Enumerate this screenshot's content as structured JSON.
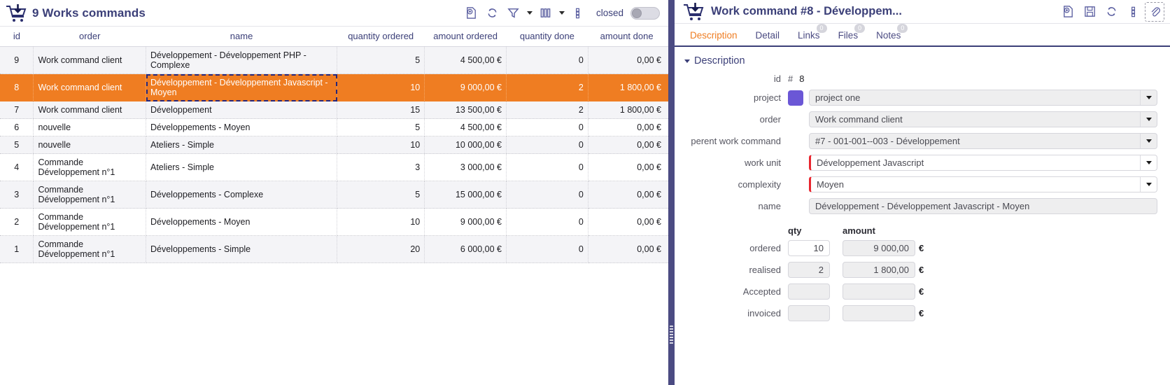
{
  "list_panel": {
    "icon": "cart-down-arrow-icon",
    "title": "9 Works commands",
    "toolbar": {
      "add_label": "add-document-icon",
      "refresh_label": "refresh-icon",
      "filter_label": "filter-icon",
      "columns_label": "columns-icon",
      "more_label": "more-vertical-icon",
      "closed_label": "closed",
      "closed_state": "off"
    },
    "columns": [
      "id",
      "order",
      "name",
      "quantity ordered",
      "amount ordered",
      "quantity done",
      "amount done"
    ],
    "rows": [
      {
        "id": "9",
        "order": "Work command client",
        "name": "Développement - Développement PHP - Complexe",
        "qty_ordered": "5",
        "amount_ordered": "4 500,00 €",
        "qty_done": "0",
        "amount_done": "0,00 €"
      },
      {
        "id": "8",
        "order": "Work command client",
        "name": "Développement - Développement Javascript - Moyen",
        "qty_ordered": "10",
        "amount_ordered": "9 000,00 €",
        "qty_done": "2",
        "amount_done": "1 800,00 €"
      },
      {
        "id": "7",
        "order": "Work command client",
        "name": "Développement",
        "qty_ordered": "15",
        "amount_ordered": "13 500,00 €",
        "qty_done": "2",
        "amount_done": "1 800,00 €"
      },
      {
        "id": "6",
        "order": "nouvelle",
        "name": "Développements - Moyen",
        "qty_ordered": "5",
        "amount_ordered": "4 500,00 €",
        "qty_done": "0",
        "amount_done": "0,00 €"
      },
      {
        "id": "5",
        "order": "nouvelle",
        "name": "Ateliers - Simple",
        "qty_ordered": "10",
        "amount_ordered": "10 000,00 €",
        "qty_done": "0",
        "amount_done": "0,00 €"
      },
      {
        "id": "4",
        "order": "Commande Développement n°1",
        "name": "Ateliers - Simple",
        "qty_ordered": "3",
        "amount_ordered": "3 000,00 €",
        "qty_done": "0",
        "amount_done": "0,00 €"
      },
      {
        "id": "3",
        "order": "Commande Développement n°1",
        "name": "Développements - Complexe",
        "qty_ordered": "5",
        "amount_ordered": "15 000,00 €",
        "qty_done": "0",
        "amount_done": "0,00 €"
      },
      {
        "id": "2",
        "order": "Commande Développement n°1",
        "name": "Développements - Moyen",
        "qty_ordered": "10",
        "amount_ordered": "9 000,00 €",
        "qty_done": "0",
        "amount_done": "0,00 €"
      },
      {
        "id": "1",
        "order": "Commande Développement n°1",
        "name": "Développements - Simple",
        "qty_ordered": "20",
        "amount_ordered": "6 000,00 €",
        "qty_done": "0",
        "amount_done": "0,00 €"
      }
    ],
    "selected_row_index": 1,
    "selection_color": "#ef7d22"
  },
  "detail_panel": {
    "icon": "cart-down-arrow-icon",
    "title": "Work command  #8  - Développem...",
    "toolbar": {
      "add_label": "add-document-icon",
      "save_label": "save-icon",
      "refresh_label": "refresh-icon",
      "more_label": "more-vertical-icon",
      "attach_label": "paperclip-icon"
    },
    "tabs": [
      {
        "label": "Description",
        "badge": "",
        "active": true
      },
      {
        "label": "Detail",
        "badge": "",
        "active": false
      },
      {
        "label": "Links",
        "badge": "0",
        "active": false
      },
      {
        "label": "Files",
        "badge": "0",
        "active": false
      },
      {
        "label": "Notes",
        "badge": "0",
        "active": false
      }
    ],
    "section_title": "Description",
    "fields": {
      "id_label": "id",
      "id_hash": "#",
      "id_value": "8",
      "project_label": "project",
      "project_color": "#6b57d6",
      "project_value": "project one",
      "order_label": "order",
      "order_value": "Work command client",
      "parent_label": "perent work command",
      "parent_value": "#7 - 001-001--003 - Développement",
      "work_unit_label": "work unit",
      "work_unit_value": "Développement Javascript",
      "complexity_label": "complexity",
      "complexity_value": "Moyen",
      "name_label": "name",
      "name_value": "Développement - Développement Javascript - Moyen"
    },
    "amounts": {
      "qty_header": "qty",
      "amount_header": "amount",
      "currency": "€",
      "lines": [
        {
          "label": "ordered",
          "qty": "10",
          "amount": "9 000,00",
          "qty_editable": true
        },
        {
          "label": "realised",
          "qty": "2",
          "amount": "1 800,00",
          "qty_editable": false
        },
        {
          "label": "Accepted",
          "qty": "",
          "amount": "",
          "qty_editable": false
        },
        {
          "label": "invoiced",
          "qty": "",
          "amount": "",
          "qty_editable": false
        }
      ]
    }
  }
}
